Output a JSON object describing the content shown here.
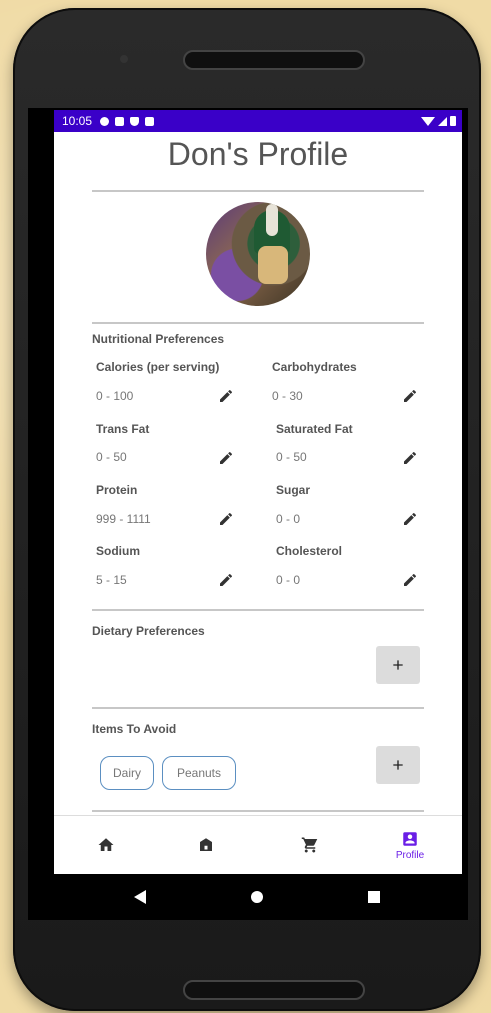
{
  "status_bar": {
    "time": "10:05",
    "icons": [
      "settings-icon",
      "notification-icon",
      "shield-icon",
      "lock-icon",
      "wifi-icon",
      "signal-icon",
      "battery-icon"
    ]
  },
  "profile": {
    "title": "Don's Profile",
    "avatar_icon": "spartan-mascot-photo"
  },
  "nutrition": {
    "heading": "Nutritional Preferences",
    "items": [
      {
        "name": "Calories (per serving)",
        "value": "0 - 100"
      },
      {
        "name": "Carbohydrates",
        "value": "0 - 30"
      },
      {
        "name": "Trans Fat",
        "value": "0 - 50"
      },
      {
        "name": "Saturated Fat",
        "value": "0 - 50"
      },
      {
        "name": "Protein",
        "value": "999 - 1111"
      },
      {
        "name": "Sugar",
        "value": "0 - 0"
      },
      {
        "name": "Sodium",
        "value": "5 - 15"
      },
      {
        "name": "Cholesterol",
        "value": "0 - 0"
      }
    ],
    "edit_icon": "pencil-icon"
  },
  "dietary": {
    "heading": "Dietary Preferences",
    "add_icon": "plus-icon"
  },
  "avoid": {
    "heading": "Items To Avoid",
    "chips": [
      "Dairy",
      "Peanuts"
    ],
    "add_icon": "plus-icon"
  },
  "bottom_nav": {
    "items": [
      {
        "icon": "home-icon",
        "label": ""
      },
      {
        "icon": "store-icon",
        "label": ""
      },
      {
        "icon": "cart-icon",
        "label": ""
      },
      {
        "icon": "profile-icon",
        "label": "Profile"
      }
    ],
    "active_index": 3,
    "active_color": "#6a1ee6"
  },
  "colors": {
    "status_bar": "#3a00c8",
    "chip_border": "#5b8fc1",
    "background": "#f0dba6"
  }
}
